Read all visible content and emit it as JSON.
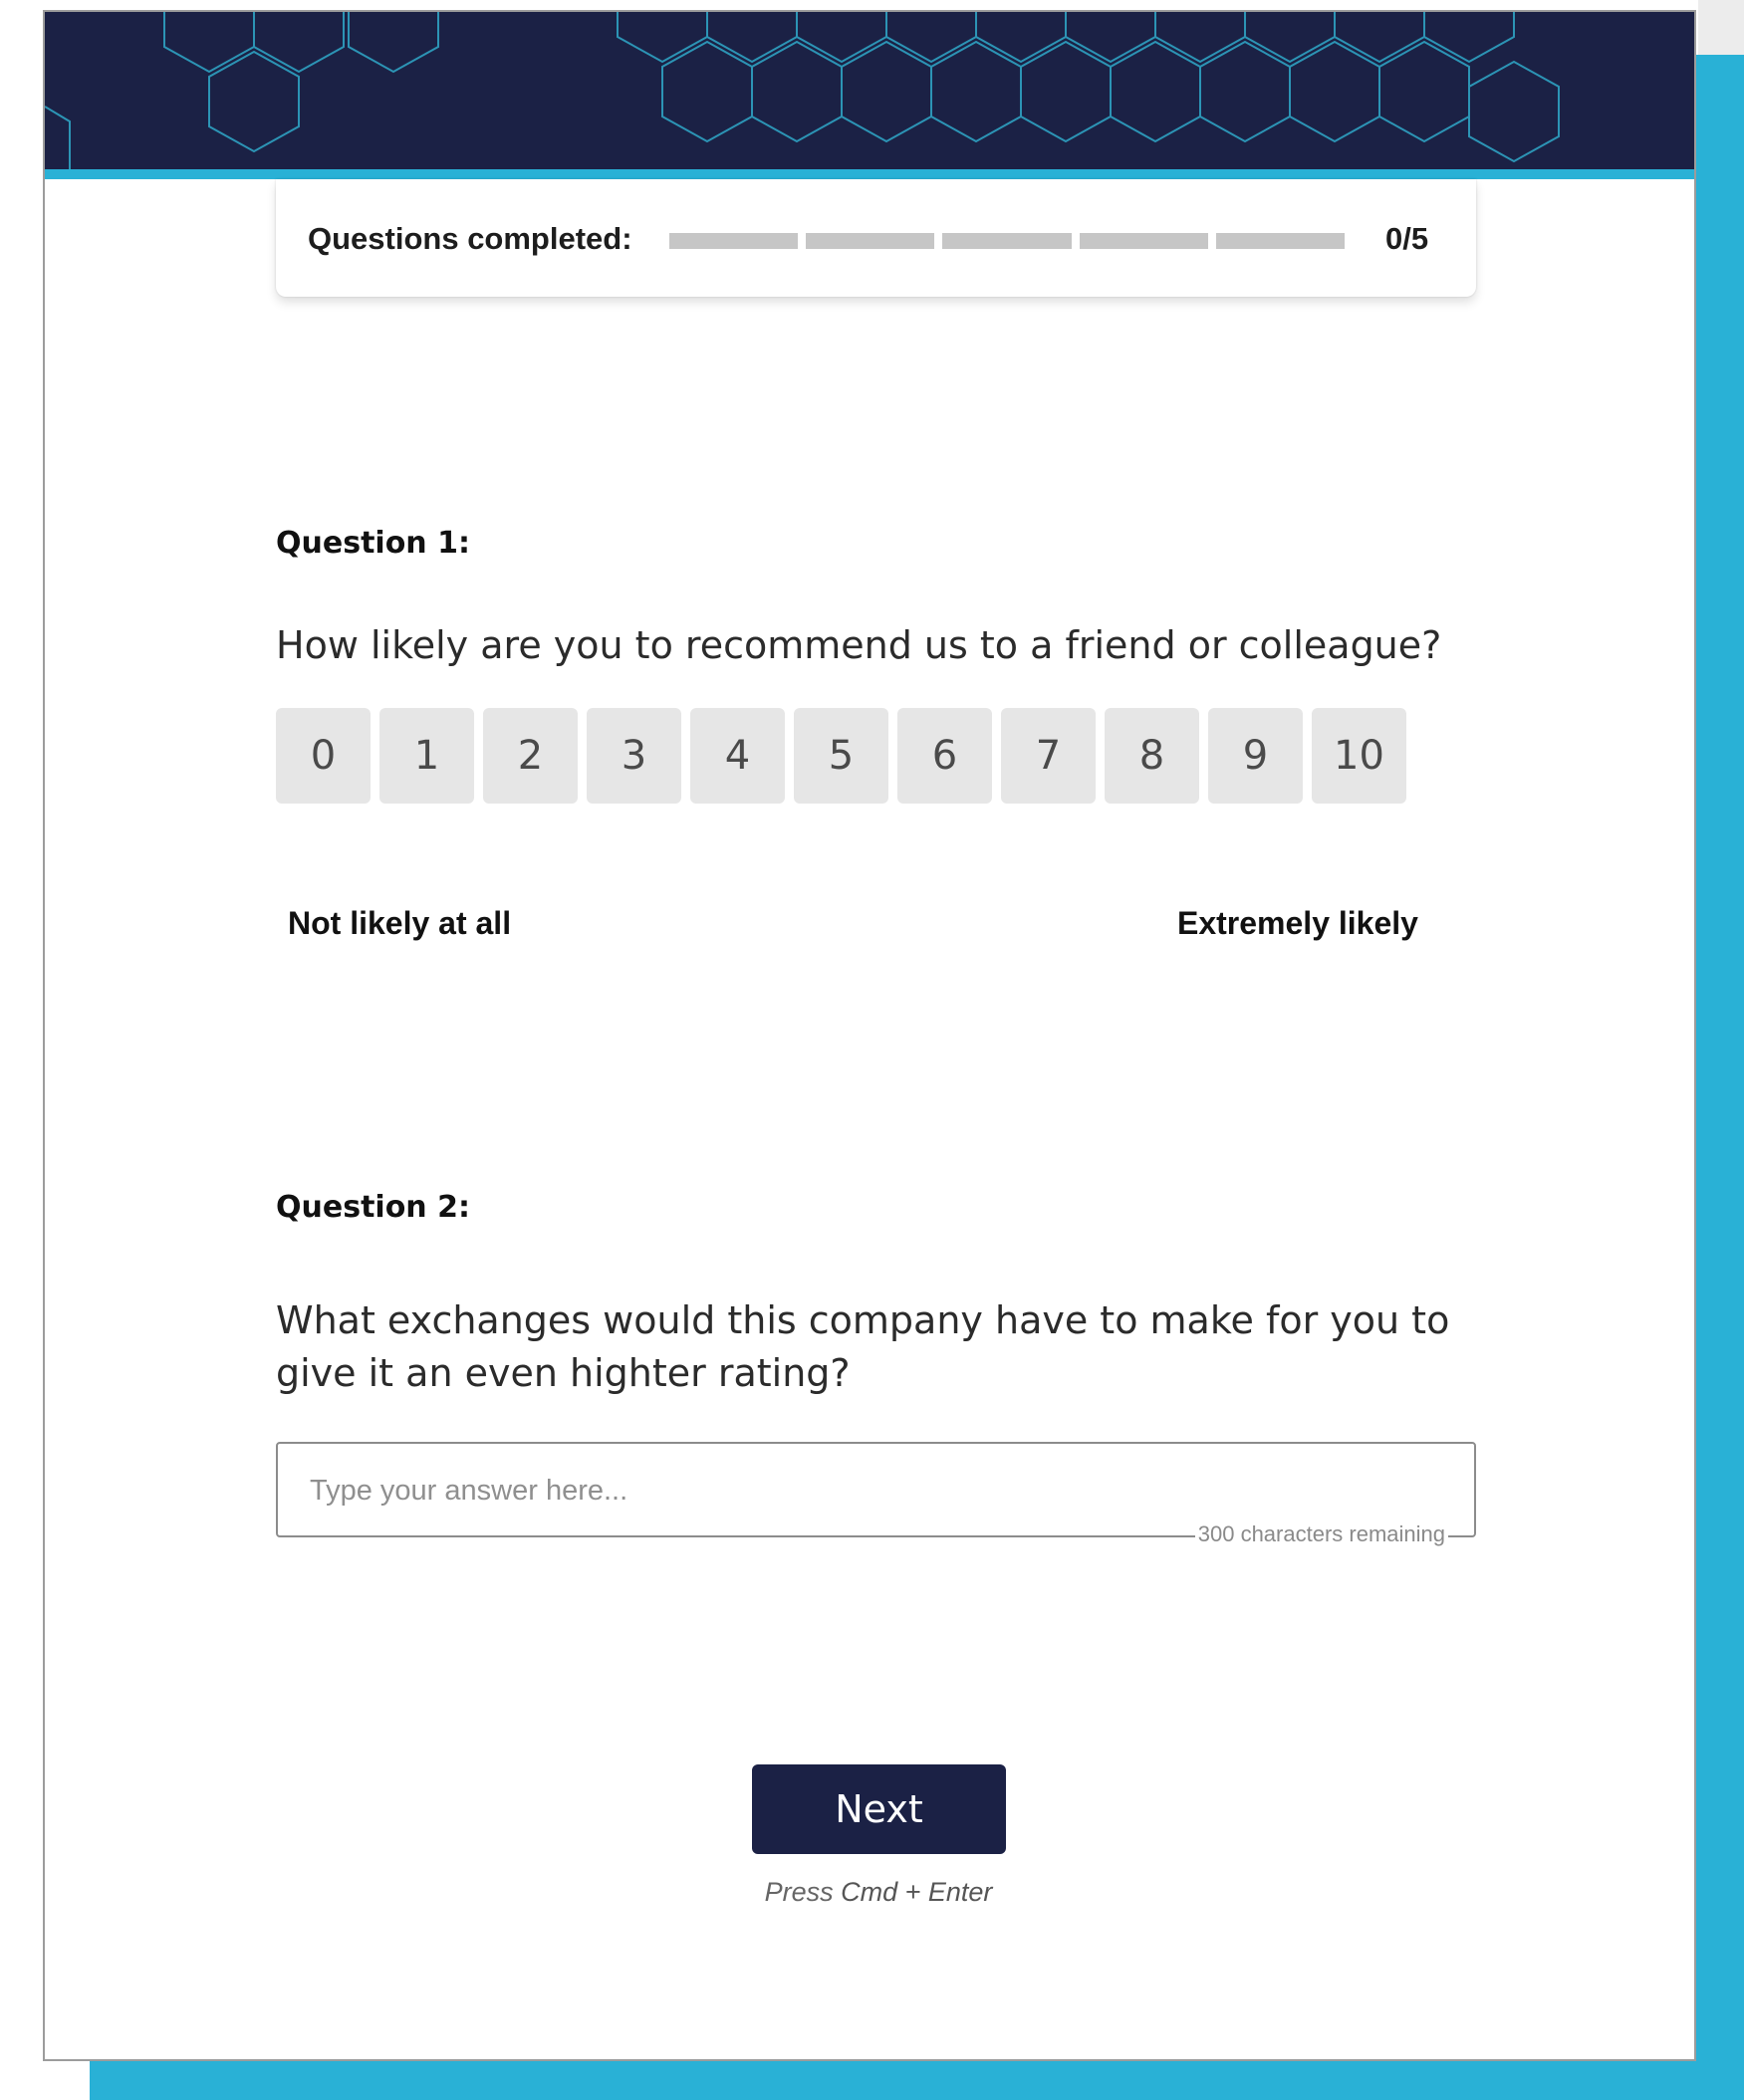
{
  "progress": {
    "label": "Questions completed:",
    "completed": 0,
    "total": 5,
    "count_text": "0/5"
  },
  "question1": {
    "label": "Question 1:",
    "text": "How likely are you to recommend us to a friend or colleague?",
    "scale": [
      "0",
      "1",
      "2",
      "3",
      "4",
      "5",
      "6",
      "7",
      "8",
      "9",
      "10"
    ],
    "low_label": "Not likely at all",
    "high_label": "Extremely likely"
  },
  "question2": {
    "label": "Question 2:",
    "text": "What exchanges would this company have to make for you to give it an even highter rating?",
    "placeholder": "Type your answer here...",
    "chars_remaining": "300 characters remaining"
  },
  "actions": {
    "next_label": "Next",
    "hint_prefix": "Press",
    "hint_keys": "Cmd + Enter"
  },
  "colors": {
    "banner": "#1b2145",
    "accent": "#29b1d6",
    "scale_button": "#e6e6e6",
    "progress_track": "#c6c6c6"
  }
}
